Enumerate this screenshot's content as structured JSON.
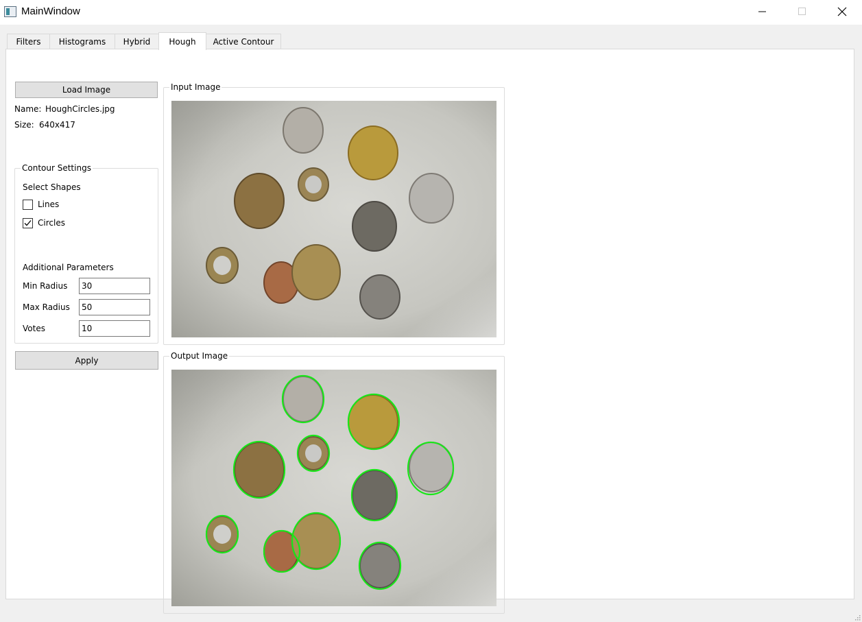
{
  "window": {
    "title": "MainWindow",
    "controls": {
      "minimize_icon": "minimize-icon",
      "maximize_icon": "maximize-icon",
      "close_icon": "close-icon"
    }
  },
  "tabs": [
    {
      "label": "Filters",
      "active": false
    },
    {
      "label": "Histograms",
      "active": false
    },
    {
      "label": "Hybrid",
      "active": false
    },
    {
      "label": "Hough",
      "active": true
    },
    {
      "label": "Active Contour",
      "active": false
    }
  ],
  "left_panel": {
    "load_button": "Load Image",
    "name_label": "Name:",
    "name_value": "HoughCircles.jpg",
    "size_label": "Size:",
    "size_value": "640x417",
    "contour_settings": {
      "title": "Contour Settings",
      "select_shapes": "Select Shapes",
      "lines": {
        "label": "Lines",
        "checked": false
      },
      "circles": {
        "label": "Circles",
        "checked": true
      },
      "additional_parameters": "Additional Parameters",
      "min_radius": {
        "label": "Min Radius",
        "value": "30"
      },
      "max_radius": {
        "label": "Max Radius",
        "value": "50"
      },
      "votes": {
        "label": "Votes",
        "value": "10"
      }
    },
    "apply_button": "Apply"
  },
  "input_group": {
    "title": "Input Image"
  },
  "output_group": {
    "title": "Output Image"
  },
  "colors": {
    "detection_circle": "#19e619",
    "background_photo": "#c9c9c4"
  }
}
